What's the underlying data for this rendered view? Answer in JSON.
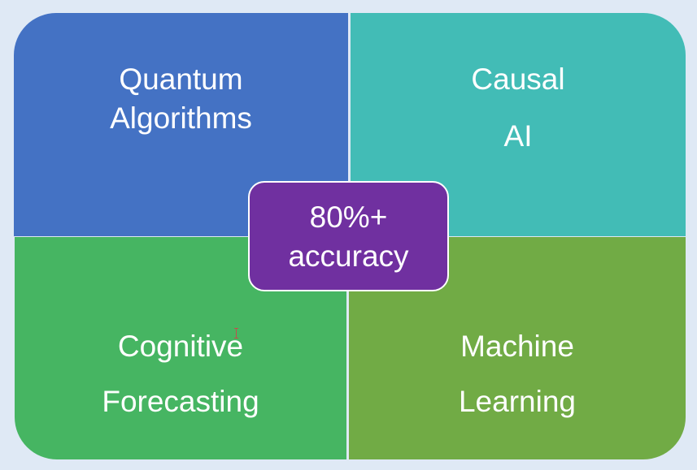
{
  "quadrants": {
    "top_left": {
      "lines": [
        "Quantum",
        "Algorithms"
      ],
      "color": "#4472c4"
    },
    "top_right": {
      "lines": [
        "Causal",
        "AI"
      ],
      "color": "#42bcb6"
    },
    "bottom_left": {
      "lines": [
        "Cognitive",
        "Forecasting"
      ],
      "color": "#46b562"
    },
    "bottom_right": {
      "lines": [
        "Machine",
        "Learning"
      ],
      "color": "#71ab45"
    }
  },
  "center": {
    "lines": [
      "80%+",
      "accuracy"
    ],
    "color": "#7030a0"
  }
}
